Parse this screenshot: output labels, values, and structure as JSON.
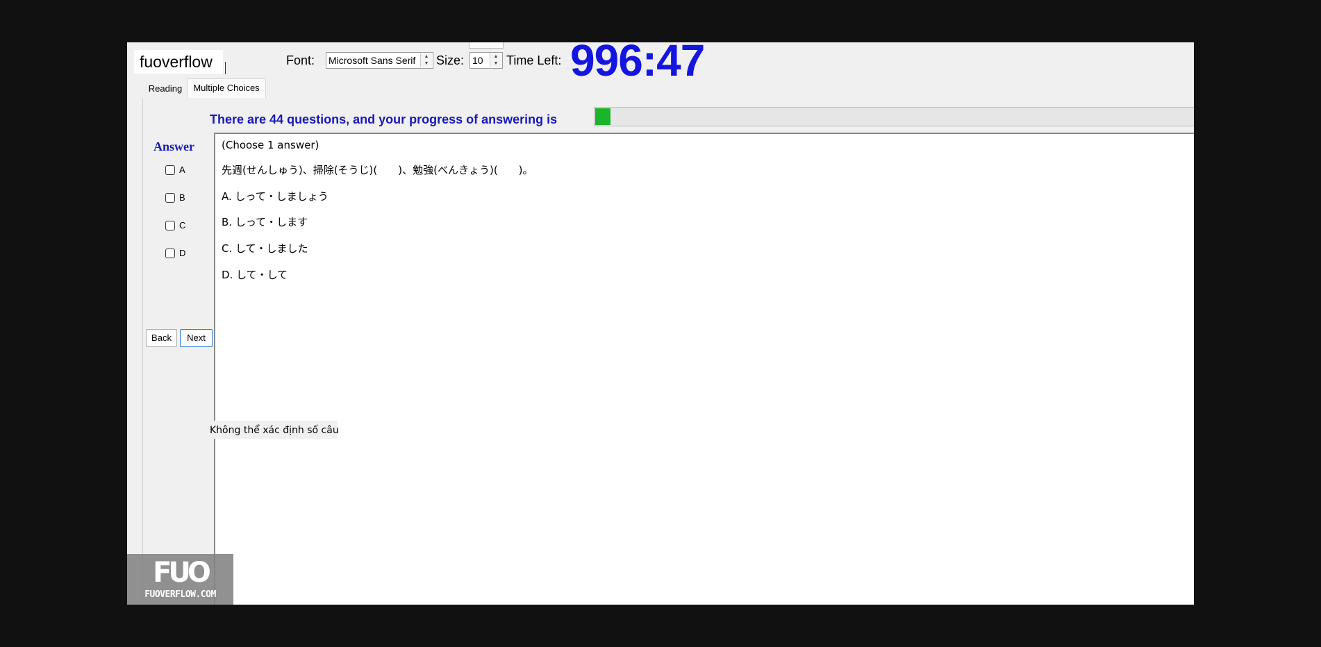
{
  "header": {
    "username": "fuoverflow",
    "font_label": "Font:",
    "font_value": "Microsoft Sans Serif",
    "size_label": "Size:",
    "size_value": "10",
    "time_label": "Time Left:",
    "timer": "996:47"
  },
  "tabs": [
    {
      "label": "Reading",
      "active": false
    },
    {
      "label": "Multiple Choices",
      "active": true
    }
  ],
  "progress": {
    "text": "There are 44 questions, and your progress of answering is",
    "fraction": 0.025,
    "fill_color": "#1ab52a"
  },
  "answer": {
    "title": "Answer",
    "options": [
      {
        "label": "A",
        "checked": false
      },
      {
        "label": "B",
        "checked": false
      },
      {
        "label": "C",
        "checked": false
      },
      {
        "label": "D",
        "checked": false
      }
    ]
  },
  "buttons": {
    "back": "Back",
    "next": "Next"
  },
  "question": {
    "instruction": "(Choose 1 answer)",
    "text": "先週(せんしゅう)、掃除(そうじ)(　　)、勉強(べんきょう)(　　)。",
    "choices": [
      "A. しって・しましょう",
      "B. しって・します",
      "C. して・しました",
      "D. して・して"
    ]
  },
  "status_message": "Không thể xác định số câu",
  "watermark": {
    "logo": "FUO",
    "site": "FUOVERFLOW.COM"
  },
  "colors": {
    "accent_blue": "#1919b8",
    "timer_blue": "#1515e0",
    "progress_green": "#1ab52a"
  }
}
